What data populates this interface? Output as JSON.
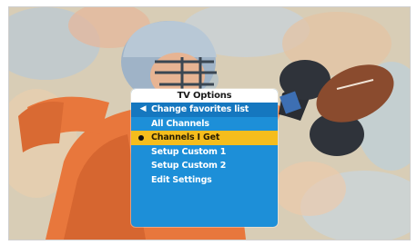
{
  "menu": {
    "title": "TV Options",
    "back_item": {
      "label": "Change favorites list",
      "icon": "chevron-left-icon"
    },
    "items": [
      {
        "label": "All Channels",
        "selected": false
      },
      {
        "label": "Channels I Get",
        "selected": true
      },
      {
        "label": "Setup Custom 1",
        "selected": false
      },
      {
        "label": "Setup Custom 2",
        "selected": false
      },
      {
        "label": "Edit Settings",
        "selected": false
      }
    ]
  },
  "colors": {
    "menu_bg": "#1d8fd8",
    "menu_back_bg": "#1577bf",
    "highlight": "#f5bd1d",
    "title_bg": "#ffffff"
  }
}
